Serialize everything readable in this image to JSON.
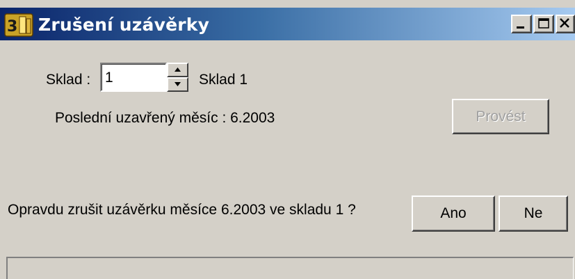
{
  "window": {
    "title": "Zrušení uzávěrky",
    "controls": {
      "minimize": "minimize",
      "maximize": "maximize",
      "close": "close"
    }
  },
  "form": {
    "sklad_label": "Sklad :",
    "sklad_value": "1",
    "sklad_name": "Sklad 1",
    "posledni_label": "Poslední uzavřený měsíc : 6.2003",
    "provest_label": "Provést",
    "confirm_question": "Opravdu zrušit uzávěrku měsíce 6.2003 ve skladu 1 ?",
    "ano_label": "Ano",
    "ne_label": "Ne"
  },
  "icons": {
    "app": "app-logo-icon",
    "spin_up": "arrow-up-icon",
    "spin_down": "arrow-down-icon"
  },
  "colors": {
    "titlebar_start": "#0a246a",
    "titlebar_end": "#a6caf0",
    "face": "#d4d0c8",
    "disabled_text": "#a0a0a0"
  }
}
